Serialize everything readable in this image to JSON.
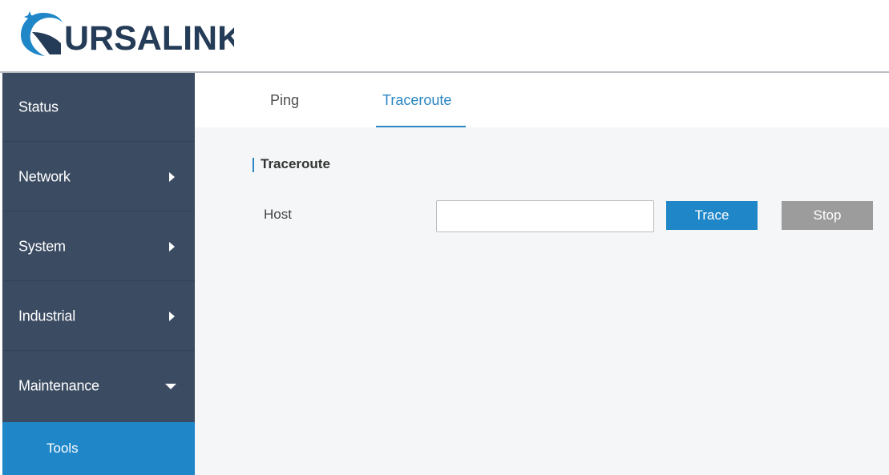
{
  "app": {
    "logo_text": "URSALINK",
    "colors": {
      "brand_blue": "#1f86c8",
      "logo_dark": "#243c57",
      "sidebar_bg": "#3b4b62",
      "active_blue": "#2a86c4",
      "stop_gray": "#9c9c9c"
    }
  },
  "sidebar": {
    "items": [
      {
        "label": "Status",
        "icon": null
      },
      {
        "label": "Network",
        "icon": "caret-right-icon"
      },
      {
        "label": "System",
        "icon": "caret-right-icon"
      },
      {
        "label": "Industrial",
        "icon": "caret-right-icon"
      },
      {
        "label": "Maintenance",
        "icon": "caret-down-icon"
      }
    ],
    "sub_items": [
      {
        "label": "Tools",
        "active": true
      }
    ]
  },
  "tabs": [
    {
      "label": "Ping",
      "active": false
    },
    {
      "label": "Traceroute",
      "active": true
    }
  ],
  "section": {
    "title": "Traceroute"
  },
  "form": {
    "host_label": "Host",
    "host_value": "",
    "trace_label": "Trace",
    "stop_label": "Stop"
  }
}
